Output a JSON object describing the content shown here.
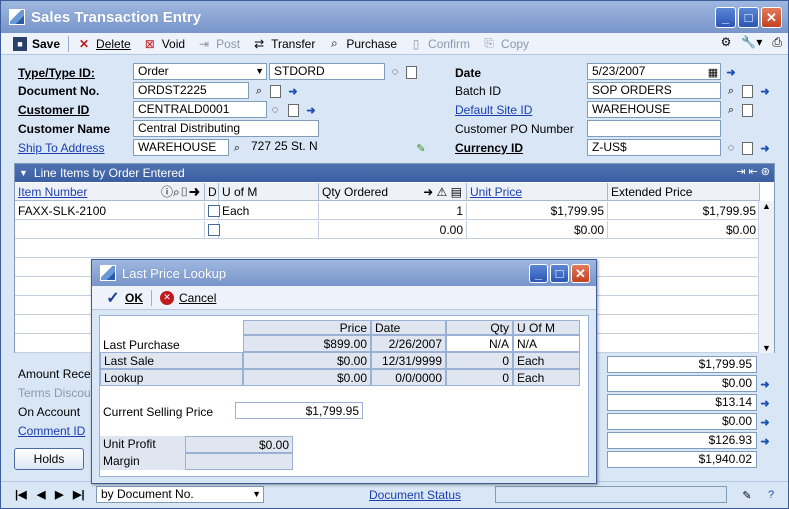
{
  "window": {
    "title": "Sales Transaction Entry"
  },
  "toolbar": {
    "save": "Save",
    "delete": "Delete",
    "void": "Void",
    "post": "Post",
    "transfer": "Transfer",
    "purchase": "Purchase",
    "confirm": "Confirm",
    "copy": "Copy"
  },
  "header": {
    "type_label": "Type/Type ID:",
    "type_value": "Order",
    "type_id_value": "STDORD",
    "docno_label": "Document No.",
    "docno_value": "ORDST2225",
    "customer_id_label": "Customer ID",
    "customer_id_value": "CENTRALD0001",
    "customer_name_label": "Customer Name",
    "customer_name_value": "Central Distributing",
    "ship_to_label": "Ship To Address",
    "ship_to_value": "WAREHOUSE",
    "ship_to_address": "727 25 St. N",
    "date_label": "Date",
    "date_value": "5/23/2007",
    "batch_label": "Batch ID",
    "batch_value": "SOP ORDERS",
    "site_label": "Default Site ID",
    "site_value": "WAREHOUSE",
    "po_label": "Customer PO Number",
    "po_value": "",
    "currency_label": "Currency ID",
    "currency_value": "Z-US$"
  },
  "grid": {
    "title": "Line Items by Order Entered",
    "columns": {
      "item": "Item Number",
      "d": "D",
      "uofm": "U of M",
      "qty": "Qty Ordered",
      "unit_price": "Unit Price",
      "extended": "Extended Price"
    },
    "rows": [
      {
        "item": "FAXX-SLK-2100",
        "uofm": "Each",
        "qty": "1",
        "unit_price": "$1,799.95",
        "extended": "$1,799.95"
      },
      {
        "item": "",
        "uofm": "",
        "qty": "0.00",
        "unit_price": "$0.00",
        "extended": "$0.00"
      }
    ]
  },
  "bottom": {
    "amount_received": "Amount Receiv",
    "terms_discount": "Terms Discoun",
    "on_account": "On Account",
    "comment_id": "Comment ID",
    "holds": "Holds",
    "sums": [
      "$1,799.95",
      "$0.00",
      "$13.14",
      "$0.00",
      "$126.93",
      "$1,940.02"
    ]
  },
  "status": {
    "sort_by": "by Document No.",
    "doc_status": "Document Status"
  },
  "dialog": {
    "title": "Last Price Lookup",
    "ok": "OK",
    "cancel": "Cancel",
    "cols": {
      "price": "Price",
      "date": "Date",
      "qty": "Qty",
      "uofm": "U Of M"
    },
    "rows": [
      {
        "label": "Last Purchase",
        "price": "$899.00",
        "date": "2/26/2007",
        "qty": "N/A",
        "uofm": "N/A"
      },
      {
        "label": "Last Sale",
        "price": "$0.00",
        "date": "12/31/9999",
        "qty": "0",
        "uofm": "Each"
      },
      {
        "label": "Lookup",
        "price": "$0.00",
        "date": "0/0/0000",
        "qty": "0",
        "uofm": "Each"
      }
    ],
    "csp_label": "Current Selling Price",
    "csp_value": "$1,799.95",
    "profit_label": "Unit Profit",
    "profit_value": "$0.00",
    "margin_label": "Margin",
    "margin_value": ""
  }
}
